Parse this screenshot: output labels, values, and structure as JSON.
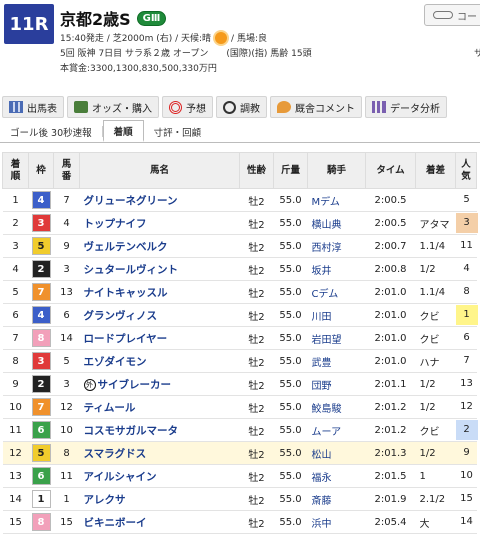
{
  "header": {
    "race_no": "11R",
    "title": "京都2歳S",
    "grade": "GⅢ",
    "course_button": "コー",
    "info_line1_a": "15:40発走 / 芝2000m (右) / 天候:晴",
    "info_line1_b": "/ 馬場:良",
    "info_line2": "5回 阪神 7日目 サラ系２歳 オープン　　(国際)(指) 馬齢 15頭",
    "info_line3": "本賞金:3300,1300,830,500,330万円",
    "edge_mark": "サ"
  },
  "tabs": [
    {
      "label": "出馬表",
      "icon": "grid-icon"
    },
    {
      "label": "オッズ・購入",
      "icon": "odds-icon"
    },
    {
      "label": "予想",
      "icon": "target-icon"
    },
    {
      "label": "調教",
      "icon": "stopwatch-icon"
    },
    {
      "label": "厩舎コメント",
      "icon": "speech-icon"
    },
    {
      "label": "データ分析",
      "icon": "bar-chart-icon"
    }
  ],
  "subtabs": [
    "ゴール後 30秒速報",
    "着順",
    "寸評・回顧"
  ],
  "active_subtab": "着順",
  "columns": [
    "着\n順",
    "枠",
    "馬\n番",
    "馬名",
    "性齢",
    "斤量",
    "騎手",
    "タイム",
    "着差",
    "人\n気"
  ],
  "colors": {
    "frame": {
      "1": {
        "bg": "#ffffff",
        "fg": "#222222"
      },
      "2": {
        "bg": "#222222",
        "fg": "#ffffff"
      },
      "3": {
        "bg": "#e03a3a",
        "fg": "#ffffff"
      },
      "4": {
        "bg": "#3c5fc9",
        "fg": "#ffffff"
      },
      "5": {
        "bg": "#f1cc2c",
        "fg": "#222222"
      },
      "6": {
        "bg": "#3aa14a",
        "fg": "#ffffff"
      },
      "7": {
        "bg": "#f0912c",
        "fg": "#ffffff"
      },
      "8": {
        "bg": "#f2a0ba",
        "fg": "#ffffff"
      }
    },
    "pop": {
      "1": "#fff58a",
      "2": "#c9dcf7",
      "3": "#f4cfa8"
    },
    "highlight_row": "#fff8dc"
  },
  "rows": [
    {
      "rank": "1",
      "frame": "4",
      "no": "7",
      "name": "グリューネグリーン",
      "sexage": "牡2",
      "weight": "55.0",
      "jockey": "Mデム",
      "time": "2:00.5",
      "margin": "",
      "pop": "5"
    },
    {
      "rank": "2",
      "frame": "3",
      "no": "4",
      "name": "トップナイフ",
      "sexage": "牡2",
      "weight": "55.0",
      "jockey": "横山典",
      "time": "2:00.5",
      "margin": "アタマ",
      "pop": "3"
    },
    {
      "rank": "3",
      "frame": "5",
      "no": "9",
      "name": "ヴェルテンベルク",
      "sexage": "牡2",
      "weight": "55.0",
      "jockey": "西村淳",
      "time": "2:00.7",
      "margin": "1.1/4",
      "pop": "11"
    },
    {
      "rank": "4",
      "frame": "2",
      "no": "3",
      "name": "シュタールヴィント",
      "sexage": "牡2",
      "weight": "55.0",
      "jockey": "坂井",
      "time": "2:00.8",
      "margin": "1/2",
      "pop": "4"
    },
    {
      "rank": "5",
      "frame": "7",
      "no": "13",
      "name": "ナイトキャッスル",
      "sexage": "牡2",
      "weight": "55.0",
      "jockey": "Cデム",
      "time": "2:01.0",
      "margin": "1.1/4",
      "pop": "8"
    },
    {
      "rank": "6",
      "frame": "4",
      "no": "6",
      "name": "グランヴィノス",
      "sexage": "牡2",
      "weight": "55.0",
      "jockey": "川田",
      "time": "2:01.0",
      "margin": "クビ",
      "pop": "1"
    },
    {
      "rank": "7",
      "frame": "8",
      "no": "14",
      "name": "ロードプレイヤー",
      "sexage": "牡2",
      "weight": "55.0",
      "jockey": "岩田望",
      "time": "2:01.0",
      "margin": "クビ",
      "pop": "6"
    },
    {
      "rank": "8",
      "frame": "3",
      "no": "5",
      "name": "エゾダイモン",
      "sexage": "牡2",
      "weight": "55.0",
      "jockey": "武豊",
      "time": "2:01.0",
      "margin": "ハナ",
      "pop": "7"
    },
    {
      "rank": "9",
      "frame": "2",
      "no": "3",
      "name": "サイブレーカー",
      "foreign_mark": "外",
      "sexage": "牡2",
      "weight": "55.0",
      "jockey": "団野",
      "time": "2:01.1",
      "margin": "1/2",
      "pop": "13"
    },
    {
      "rank": "10",
      "frame": "7",
      "no": "12",
      "name": "ティムール",
      "sexage": "牡2",
      "weight": "55.0",
      "jockey": "鮫島駿",
      "time": "2:01.2",
      "margin": "1/2",
      "pop": "12"
    },
    {
      "rank": "11",
      "frame": "6",
      "no": "10",
      "name": "コスモサガルマータ",
      "sexage": "牡2",
      "weight": "55.0",
      "jockey": "ムーア",
      "time": "2:01.2",
      "margin": "クビ",
      "pop": "2"
    },
    {
      "rank": "12",
      "frame": "5",
      "no": "8",
      "name": "スマラグドス",
      "sexage": "牡2",
      "weight": "55.0",
      "jockey": "松山",
      "time": "2:01.3",
      "margin": "1/2",
      "pop": "9",
      "highlight": true
    },
    {
      "rank": "13",
      "frame": "6",
      "no": "11",
      "name": "アイルシャイン",
      "sexage": "牡2",
      "weight": "55.0",
      "jockey": "福永",
      "time": "2:01.5",
      "margin": "1",
      "pop": "10"
    },
    {
      "rank": "14",
      "frame": "1",
      "no": "1",
      "name": "アレクサ",
      "sexage": "牡2",
      "weight": "55.0",
      "jockey": "斎藤",
      "time": "2:01.9",
      "margin": "2.1/2",
      "pop": "15"
    },
    {
      "rank": "15",
      "frame": "8",
      "no": "15",
      "name": "ビキニボーイ",
      "sexage": "牡2",
      "weight": "55.0",
      "jockey": "浜中",
      "time": "2:05.4",
      "margin": "大",
      "pop": "14"
    }
  ]
}
